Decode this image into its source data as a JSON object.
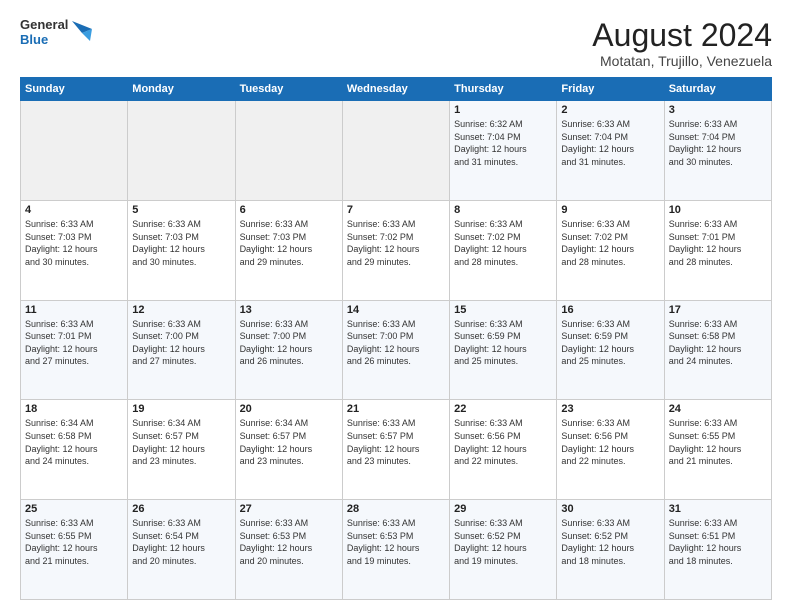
{
  "logo": {
    "general": "General",
    "blue": "Blue"
  },
  "title": "August 2024",
  "subtitle": "Motatan, Trujillo, Venezuela",
  "days_of_week": [
    "Sunday",
    "Monday",
    "Tuesday",
    "Wednesday",
    "Thursday",
    "Friday",
    "Saturday"
  ],
  "weeks": [
    [
      {
        "day": "",
        "info": ""
      },
      {
        "day": "",
        "info": ""
      },
      {
        "day": "",
        "info": ""
      },
      {
        "day": "",
        "info": ""
      },
      {
        "day": "1",
        "info": "Sunrise: 6:32 AM\nSunset: 7:04 PM\nDaylight: 12 hours\nand 31 minutes."
      },
      {
        "day": "2",
        "info": "Sunrise: 6:33 AM\nSunset: 7:04 PM\nDaylight: 12 hours\nand 31 minutes."
      },
      {
        "day": "3",
        "info": "Sunrise: 6:33 AM\nSunset: 7:04 PM\nDaylight: 12 hours\nand 30 minutes."
      }
    ],
    [
      {
        "day": "4",
        "info": "Sunrise: 6:33 AM\nSunset: 7:03 PM\nDaylight: 12 hours\nand 30 minutes."
      },
      {
        "day": "5",
        "info": "Sunrise: 6:33 AM\nSunset: 7:03 PM\nDaylight: 12 hours\nand 30 minutes."
      },
      {
        "day": "6",
        "info": "Sunrise: 6:33 AM\nSunset: 7:03 PM\nDaylight: 12 hours\nand 29 minutes."
      },
      {
        "day": "7",
        "info": "Sunrise: 6:33 AM\nSunset: 7:02 PM\nDaylight: 12 hours\nand 29 minutes."
      },
      {
        "day": "8",
        "info": "Sunrise: 6:33 AM\nSunset: 7:02 PM\nDaylight: 12 hours\nand 28 minutes."
      },
      {
        "day": "9",
        "info": "Sunrise: 6:33 AM\nSunset: 7:02 PM\nDaylight: 12 hours\nand 28 minutes."
      },
      {
        "day": "10",
        "info": "Sunrise: 6:33 AM\nSunset: 7:01 PM\nDaylight: 12 hours\nand 28 minutes."
      }
    ],
    [
      {
        "day": "11",
        "info": "Sunrise: 6:33 AM\nSunset: 7:01 PM\nDaylight: 12 hours\nand 27 minutes."
      },
      {
        "day": "12",
        "info": "Sunrise: 6:33 AM\nSunset: 7:00 PM\nDaylight: 12 hours\nand 27 minutes."
      },
      {
        "day": "13",
        "info": "Sunrise: 6:33 AM\nSunset: 7:00 PM\nDaylight: 12 hours\nand 26 minutes."
      },
      {
        "day": "14",
        "info": "Sunrise: 6:33 AM\nSunset: 7:00 PM\nDaylight: 12 hours\nand 26 minutes."
      },
      {
        "day": "15",
        "info": "Sunrise: 6:33 AM\nSunset: 6:59 PM\nDaylight: 12 hours\nand 25 minutes."
      },
      {
        "day": "16",
        "info": "Sunrise: 6:33 AM\nSunset: 6:59 PM\nDaylight: 12 hours\nand 25 minutes."
      },
      {
        "day": "17",
        "info": "Sunrise: 6:33 AM\nSunset: 6:58 PM\nDaylight: 12 hours\nand 24 minutes."
      }
    ],
    [
      {
        "day": "18",
        "info": "Sunrise: 6:34 AM\nSunset: 6:58 PM\nDaylight: 12 hours\nand 24 minutes."
      },
      {
        "day": "19",
        "info": "Sunrise: 6:34 AM\nSunset: 6:57 PM\nDaylight: 12 hours\nand 23 minutes."
      },
      {
        "day": "20",
        "info": "Sunrise: 6:34 AM\nSunset: 6:57 PM\nDaylight: 12 hours\nand 23 minutes."
      },
      {
        "day": "21",
        "info": "Sunrise: 6:33 AM\nSunset: 6:57 PM\nDaylight: 12 hours\nand 23 minutes."
      },
      {
        "day": "22",
        "info": "Sunrise: 6:33 AM\nSunset: 6:56 PM\nDaylight: 12 hours\nand 22 minutes."
      },
      {
        "day": "23",
        "info": "Sunrise: 6:33 AM\nSunset: 6:56 PM\nDaylight: 12 hours\nand 22 minutes."
      },
      {
        "day": "24",
        "info": "Sunrise: 6:33 AM\nSunset: 6:55 PM\nDaylight: 12 hours\nand 21 minutes."
      }
    ],
    [
      {
        "day": "25",
        "info": "Sunrise: 6:33 AM\nSunset: 6:55 PM\nDaylight: 12 hours\nand 21 minutes."
      },
      {
        "day": "26",
        "info": "Sunrise: 6:33 AM\nSunset: 6:54 PM\nDaylight: 12 hours\nand 20 minutes."
      },
      {
        "day": "27",
        "info": "Sunrise: 6:33 AM\nSunset: 6:53 PM\nDaylight: 12 hours\nand 20 minutes."
      },
      {
        "day": "28",
        "info": "Sunrise: 6:33 AM\nSunset: 6:53 PM\nDaylight: 12 hours\nand 19 minutes."
      },
      {
        "day": "29",
        "info": "Sunrise: 6:33 AM\nSunset: 6:52 PM\nDaylight: 12 hours\nand 19 minutes."
      },
      {
        "day": "30",
        "info": "Sunrise: 6:33 AM\nSunset: 6:52 PM\nDaylight: 12 hours\nand 18 minutes."
      },
      {
        "day": "31",
        "info": "Sunrise: 6:33 AM\nSunset: 6:51 PM\nDaylight: 12 hours\nand 18 minutes."
      }
    ]
  ]
}
